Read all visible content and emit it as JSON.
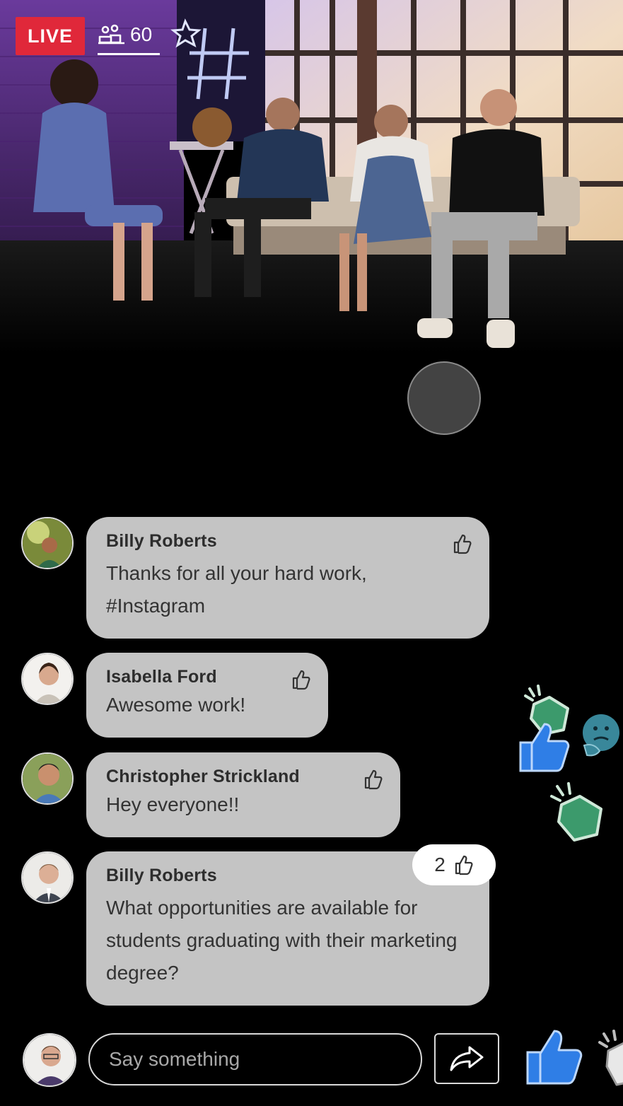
{
  "live": {
    "badge_label": "LIVE",
    "viewer_count": "60"
  },
  "comments": [
    {
      "author": "Billy Roberts",
      "message": "Thanks for all your hard work, #Instagram"
    },
    {
      "author": "Isabella Ford",
      "message": "Awesome work!"
    },
    {
      "author": "Christopher Strickland",
      "message": "Hey everyone!!"
    },
    {
      "author": "Billy Roberts",
      "message": "What opportunities are available for students graduating with their marketing degree?",
      "like_count": "2"
    }
  ],
  "composer": {
    "placeholder": "Say something"
  },
  "icons": {
    "viewers": "people-icon",
    "like": "thumbs-up-outline-icon",
    "share": "share-arrow-icon",
    "thumb_reaction": "thumbs-up-icon",
    "clap_reaction": "clapping-hands-icon"
  },
  "colors": {
    "live_badge": "#e0283a",
    "bubble": "#c4c4c4",
    "thumb_blue": "#2f7ee6",
    "clap_green": "#3c9a6c",
    "background": "#000000"
  }
}
